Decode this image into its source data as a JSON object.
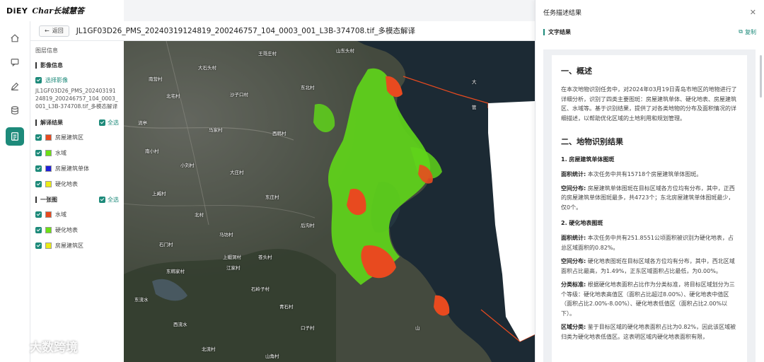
{
  "brand": {
    "part1": "DiEY",
    "part2": "Char长城慧答"
  },
  "topbar": {
    "back_label": "返回",
    "title": "JL1GF03D26_PMS_20240319124819_200246757_104_0003_001_L3B-374708.tif_多模态解译"
  },
  "rail": {
    "icons": [
      "home-icon",
      "chat-icon",
      "edit-icon",
      "database-icon",
      "report-icon"
    ]
  },
  "layers": {
    "section_title": "图层信息",
    "image_group": {
      "title": "影像信息",
      "select_label": "选择影像",
      "file_name": "JL1GF03D26_PMS_20240319124819_200246757_104_0003_001_L3B-374708.tif_多模态解译"
    },
    "result_group": {
      "title": "解译结果",
      "all_label": "全选",
      "items": [
        {
          "label": "房屋建筑区",
          "color": "#e84a1f"
        },
        {
          "label": "水域",
          "color": "#6ee016"
        },
        {
          "label": "房屋建筑单体",
          "color": "#2020d8"
        },
        {
          "label": "硬化地表",
          "color": "#ecec18"
        }
      ]
    },
    "first_group": {
      "title": "一张图",
      "all_label": "全选",
      "items": [
        {
          "label": "水域",
          "color": "#e84a1f"
        },
        {
          "label": "硬化地表",
          "color": "#6ee016"
        },
        {
          "label": "房屋建筑区",
          "color": "#ecec18"
        }
      ]
    }
  },
  "map": {
    "labels": [
      "王哥庄村",
      "南营村",
      "大石头村",
      "北宅村",
      "山东头村",
      "沙子口村",
      "流亭",
      "东北村",
      "马家村",
      "南小村",
      "西韩村",
      "小刘村",
      "大庄村",
      "上臧村",
      "东庄村",
      "北村",
      "后沟村",
      "马坊村",
      "石门村",
      "苍头村",
      "东流水",
      "西流水",
      "江家村",
      "青石村",
      "口子村",
      "东韩家村",
      "石岭子村",
      "北流村",
      "山角村",
      "上蝦洞村",
      "大",
      "管",
      "山"
    ]
  },
  "panel": {
    "header": "任务描述结果",
    "sub_title": "文字结果",
    "copy_label": "复制",
    "s1_title": "一、概述",
    "s1_body": "在本次地物识别任务中，对2024年03月19日青岛市地区的地物进行了详细分析，识别了四类主要图斑：房屋建筑单体、硬化地表、房屋建筑区、水域等。基于识别结果，提供了对各类地物的分布及面积情况的详细描述，以帮助优化区域的土地利用和规划管理。",
    "s2_title": "二、地物识别结果",
    "sub1_title": "1. 房屋建筑单体图斑",
    "sub1_p1_lead": "面积统计:",
    "sub1_p1": " 本次任务中共有15718个房屋建筑单体图斑。",
    "sub1_p2_lead": "空间分布:",
    "sub1_p2": " 房屋建筑单体图斑在目标区域各方位均有分布，其中，正西的房屋建筑单体图斑最多，共4723个；东北房屋建筑单体图斑最少，仅0个。",
    "sub2_title": "2. 硬化地表图斑",
    "sub2_p1_lead": "面积统计:",
    "sub2_p1": " 本次任务中共有251.8551公顷面积被识别为硬化地表，占总区域面积的0.82%。",
    "sub2_p2_lead": "空间分布:",
    "sub2_p2": " 硬化地表图斑在目标区域各方位均有分布，其中，西北区域面积占比最高，为1.49%，正东区域面积占比最低，为0.00%。",
    "sub2_p3_lead": "分类标准:",
    "sub2_p3": " 根据硬化地表面积占比作为分类标准，将目标区域划分为三个等级：硬化地表高值区（面积占比超过8.00%）、硬化地表中值区（面积占比2.00%-8.00%）、硬化地表低值区（面积占比2.00%以下）。",
    "sub2_p4_lead": "区域分类:",
    "sub2_p4": " 鉴于目标区域的硬化地表面积占比为0.82%，因此该区域被归类为硬化地表低值区。这表明区域内硬化地表面积有限，"
  },
  "watermark": {
    "text": "大数跨境"
  }
}
